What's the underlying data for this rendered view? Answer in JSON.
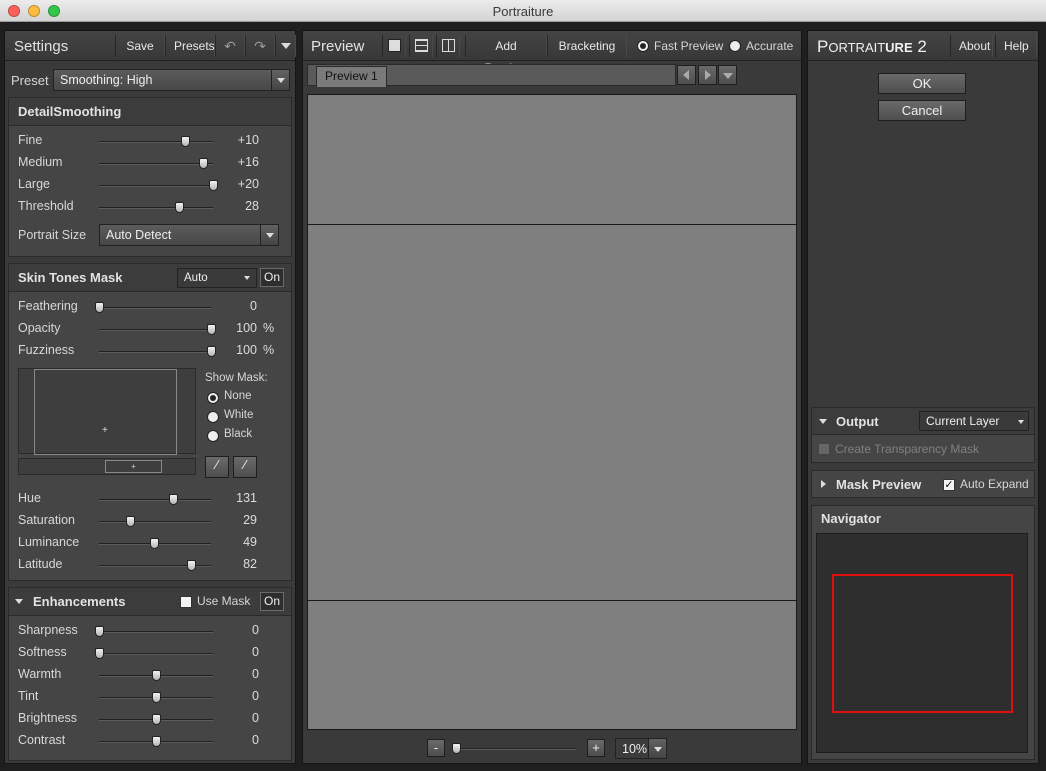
{
  "window": {
    "title": "Portraiture"
  },
  "settings": {
    "title": "Settings",
    "save": "Save",
    "presets": "Presets",
    "preset_label": "Preset",
    "preset_value": "Smoothing: High"
  },
  "detail": {
    "title": "DetailSmoothing",
    "sliders": [
      {
        "label": "Fine",
        "value": "+10",
        "pct": 0.75
      },
      {
        "label": "Medium",
        "value": "+16",
        "pct": 0.91
      },
      {
        "label": "Large",
        "value": "+20",
        "pct": 1.0
      },
      {
        "label": "Threshold",
        "value": "28",
        "pct": 0.7
      }
    ],
    "portrait_size_label": "Portrait Size",
    "portrait_size_value": "Auto Detect"
  },
  "skin": {
    "title": "Skin Tones Mask",
    "mode": "Auto",
    "on": "On",
    "sliders": [
      {
        "label": "Feathering",
        "value": "0",
        "unit": "",
        "pct": 0.0
      },
      {
        "label": "Opacity",
        "value": "100",
        "unit": "%",
        "pct": 1.0
      },
      {
        "label": "Fuzziness",
        "value": "100",
        "unit": "%",
        "pct": 1.0
      }
    ],
    "show_mask_label": "Show Mask:",
    "mask_options": [
      "None",
      "White",
      "Black"
    ],
    "mask_selected": "None",
    "hsl": [
      {
        "label": "Hue",
        "value": "131",
        "pct": 0.66
      },
      {
        "label": "Saturation",
        "value": "29",
        "pct": 0.28
      },
      {
        "label": "Luminance",
        "value": "49",
        "pct": 0.49
      },
      {
        "label": "Latitude",
        "value": "82",
        "pct": 0.82
      }
    ]
  },
  "enh": {
    "title": "Enhancements",
    "use_mask": "Use Mask",
    "on": "On",
    "sliders": [
      {
        "label": "Sharpness",
        "value": "0",
        "pct": 0.0
      },
      {
        "label": "Softness",
        "value": "0",
        "pct": 0.0
      },
      {
        "label": "Warmth",
        "value": "0",
        "pct": 0.5
      },
      {
        "label": "Tint",
        "value": "0",
        "pct": 0.5
      },
      {
        "label": "Brightness",
        "value": "0",
        "pct": 0.5
      },
      {
        "label": "Contrast",
        "value": "0",
        "pct": 0.5
      }
    ]
  },
  "preview": {
    "title": "Preview",
    "add_preview": "Add Preview",
    "bracketing": "Bracketing",
    "fast_preview": "Fast Preview",
    "accurate": "Accurate",
    "tab": "Preview 1",
    "zoom_minus": "-",
    "zoom_plus": "+",
    "zoom_value": "10%"
  },
  "right": {
    "brand_p": "P",
    "brand_ortrait": "ORTRAIT",
    "brand_ure": "URE",
    "brand_num": " 2",
    "about": "About",
    "help": "Help",
    "ok": "OK",
    "cancel": "Cancel",
    "output_label": "Output",
    "output_value": "Current Layer",
    "create_mask": "Create Transparency Mask",
    "mask_preview": "Mask Preview",
    "auto_expand": "Auto Expand",
    "navigator": "Navigator"
  },
  "colors": {
    "accent": "#e01010",
    "panel": "#3a3a3a",
    "canvas": "#7f7f7f"
  }
}
